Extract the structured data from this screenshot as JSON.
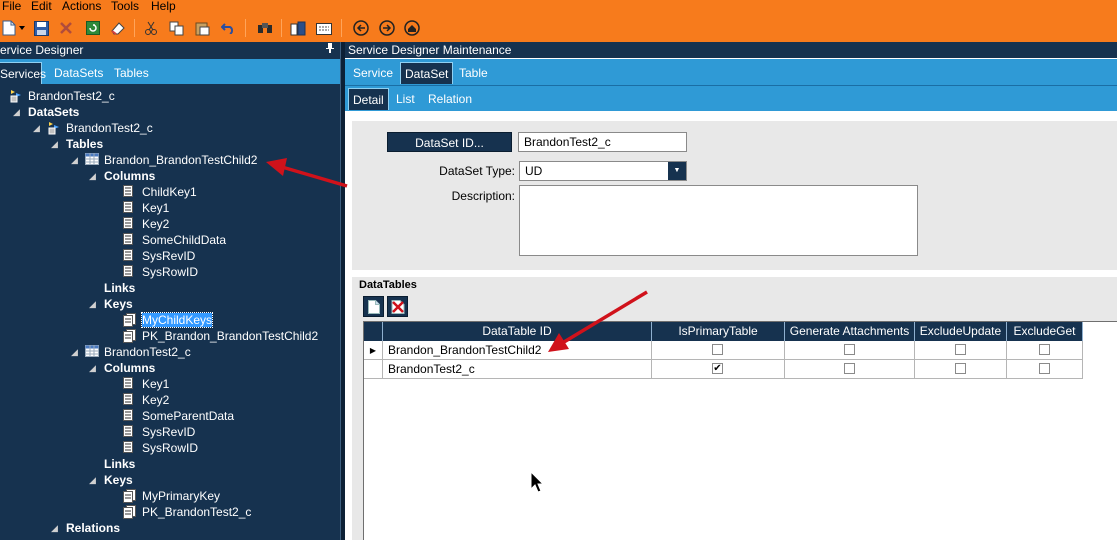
{
  "menu": [
    "File",
    "Edit",
    "Actions",
    "Tools",
    "Help"
  ],
  "toolbar_icons": [
    "new-icon",
    "save-icon",
    "delete-icon",
    "refresh-icon",
    "clear-icon",
    "cut-icon",
    "copy-icon",
    "paste-icon",
    "undo-icon",
    "search-icon",
    "attachment-icon",
    "calculator-icon",
    "back-icon",
    "forward-icon",
    "home-icon"
  ],
  "left_panel": {
    "title": "ervice Designer",
    "pin_icon": "pin-icon",
    "tabs": [
      "Services",
      "DataSets",
      "Tables"
    ],
    "tree": {
      "root": "BrandonTest2_c",
      "datasets": "DataSets",
      "dataset": "BrandonTest2_c",
      "tables": "Tables",
      "child_table": "Brandon_BrandonTestChild2",
      "child_columns_label": "Columns",
      "child_columns": [
        "ChildKey1",
        "Key1",
        "Key2",
        "SomeChildData",
        "SysRevID",
        "SysRowID"
      ],
      "child_links": "Links",
      "child_keys_label": "Keys",
      "child_keys": [
        "MyChildKeys",
        "PK_Brandon_BrandonTestChild2"
      ],
      "parent_table": "BrandonTest2_c",
      "parent_columns_label": "Columns",
      "parent_columns": [
        "Key1",
        "Key2",
        "SomeParentData",
        "SysRevID",
        "SysRowID"
      ],
      "parent_links": "Links",
      "parent_keys_label": "Keys",
      "parent_keys": [
        "MyPrimaryKey",
        "PK_BrandonTest2_c"
      ],
      "relations": "Relations"
    }
  },
  "right_panel": {
    "title": "Service Designer Maintenance",
    "tabs": [
      "Service",
      "DataSet",
      "Table"
    ],
    "subtabs": [
      "Detail",
      "List",
      "Relation"
    ],
    "dataset_id_button": "DataSet ID...",
    "dataset_id_value": "BrandonTest2_c",
    "dataset_type_label": "DataSet Type:",
    "dataset_type_value": "UD",
    "description_label": "Description:",
    "description_value": "",
    "datatables_title": "DataTables",
    "grid": {
      "columns": [
        "DataTable ID",
        "IsPrimaryTable",
        "Generate Attachments",
        "ExcludeUpdate",
        "ExcludeGet"
      ],
      "rows": [
        {
          "id": "Brandon_BrandonTestChild2",
          "is_primary": false,
          "generate_attachments": false,
          "exclude_update": false,
          "exclude_get": false,
          "current": true
        },
        {
          "id": "BrandonTest2_c",
          "is_primary": true,
          "generate_attachments": false,
          "exclude_update": false,
          "exclude_get": false,
          "current": false
        }
      ]
    }
  },
  "colors": {
    "menubar": "#f77b1c",
    "panel_dark": "#16324f",
    "tab_blue": "#2f9ad6",
    "annotation_arrow": "#d0121b",
    "selection": "#3399ff"
  }
}
